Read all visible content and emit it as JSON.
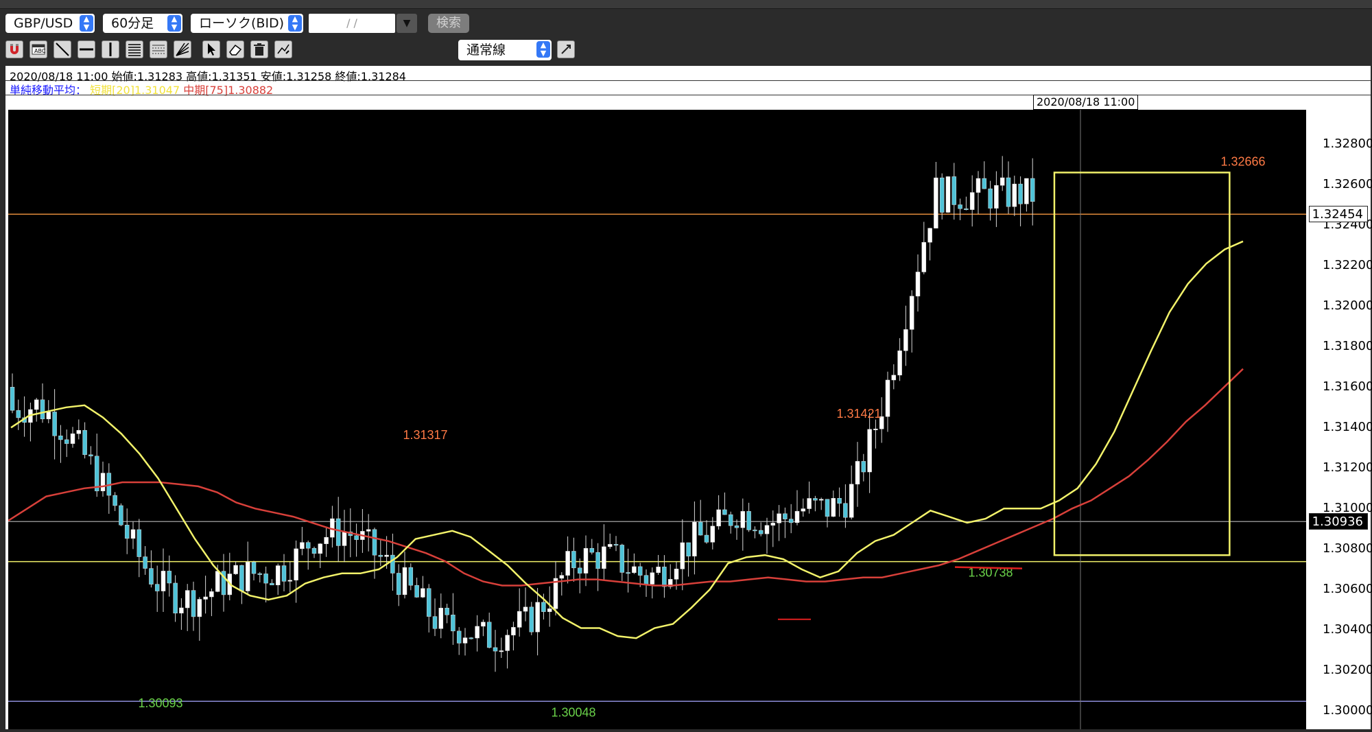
{
  "toolbar": {
    "symbol": "GBP/USD",
    "timeframe": "60分足",
    "chart_type": "ローソク(BID)",
    "date_placeholder": "/ /",
    "search_label": "検索",
    "line_width": "1",
    "line_style": "通常線",
    "palette": [
      "#62c8e8",
      "#f29a4a",
      "#f7e94a",
      "#63d24a",
      "#f08ce8",
      "#e83a78",
      "#999999",
      "#4aa0f0"
    ],
    "highlight_color": "#fbf29a",
    "tools": [
      "magnet-icon",
      "text-box-icon",
      "trend-line-icon",
      "horizontal-line-icon",
      "vertical-line-icon",
      "fibonacci-icon",
      "channel-icon",
      "gann-fan-icon",
      "pointer-icon",
      "eraser-icon",
      "trash-icon",
      "auto-draw-icon"
    ]
  },
  "info": {
    "ohlc_line": "2020/08/18 11:00 始値:1.31283 高値:1.31351 安値:1.31258 終値:1.31284",
    "ma_label": "単純移動平均：",
    "ma_short": "短期[20]1.31047",
    "ma_mid": "中期[75]1.30882"
  },
  "crosshair": {
    "time_label": "2020/08/18 11:00"
  },
  "chart_data": {
    "type": "candlestick",
    "y_ticks": [
      "1.32800",
      "1.32600",
      "1.32400",
      "1.32200",
      "1.32000",
      "1.31800",
      "1.31600",
      "1.31400",
      "1.31200",
      "1.31000",
      "1.30800",
      "1.30600",
      "1.30400",
      "1.30200",
      "1.30000"
    ],
    "ylim": [
      1.2991,
      1.3297
    ],
    "price_badges": [
      {
        "value": "1.30936",
        "style": "dark"
      },
      {
        "value": "1.32454",
        "style": "light"
      }
    ],
    "horizontal_lines": [
      {
        "value": 1.32454,
        "color": "#e08a3a"
      },
      {
        "value": 1.30936,
        "color": "#8a8a8a"
      },
      {
        "value": 1.30738,
        "color": "#f2f26a"
      },
      {
        "value": 1.30048,
        "color": "#8c8cd8"
      }
    ],
    "annotations": [
      {
        "text": "1.32666",
        "price": 1.32666,
        "color": "#ff7a45",
        "pos": "above"
      },
      {
        "text": "1.31421",
        "price": 1.31421,
        "color": "#ff7a45",
        "pos": "above"
      },
      {
        "text": "1.31317",
        "price": 1.31317,
        "color": "#ff7a45",
        "pos": "above"
      },
      {
        "text": "1.30093",
        "price": 1.30093,
        "color": "#6ad24a",
        "pos": "below"
      },
      {
        "text": "1.30048",
        "price": 1.30048,
        "color": "#6ad24a",
        "pos": "below"
      },
      {
        "text": "1.30738",
        "price": 1.30738,
        "color": "#6ad24a",
        "pos": "below"
      }
    ],
    "ma_short": {
      "period": 20,
      "color": "#f2f26a",
      "points": [
        1.314,
        1.3146,
        1.3148,
        1.315,
        1.3151,
        1.3145,
        1.3137,
        1.3127,
        1.3115,
        1.31,
        1.3085,
        1.3072,
        1.3062,
        1.3057,
        1.3055,
        1.3057,
        1.3063,
        1.3066,
        1.3068,
        1.3068,
        1.307,
        1.3076,
        1.3085,
        1.3087,
        1.3089,
        1.3086,
        1.3079,
        1.3072,
        1.3063,
        1.3055,
        1.3046,
        1.3041,
        1.3041,
        1.3037,
        1.3036,
        1.3041,
        1.3043,
        1.3051,
        1.306,
        1.3073,
        1.3076,
        1.3077,
        1.3075,
        1.307,
        1.3066,
        1.3069,
        1.3078,
        1.3084,
        1.3087,
        1.3093,
        1.3099,
        1.3096,
        1.3093,
        1.3095,
        1.31,
        1.31,
        1.31,
        1.3104,
        1.311,
        1.3122,
        1.3138,
        1.3158,
        1.3178,
        1.3197,
        1.3211,
        1.3221,
        1.3228,
        1.3232
      ]
    },
    "ma_mid": {
      "period": 75,
      "color": "#d8403a",
      "points": [
        1.3094,
        1.31,
        1.3106,
        1.3108,
        1.311,
        1.3111,
        1.3113,
        1.3113,
        1.3113,
        1.3112,
        1.3111,
        1.3108,
        1.3103,
        1.31,
        1.3098,
        1.3096,
        1.3093,
        1.309,
        1.3088,
        1.3086,
        1.3084,
        1.3081,
        1.3078,
        1.3074,
        1.3068,
        1.3064,
        1.3062,
        1.3062,
        1.3063,
        1.3064,
        1.3065,
        1.3065,
        1.3064,
        1.3063,
        1.3062,
        1.3062,
        1.3063,
        1.3064,
        1.3064,
        1.3065,
        1.3066,
        1.3065,
        1.3064,
        1.3064,
        1.3065,
        1.3066,
        1.3066,
        1.3068,
        1.307,
        1.3072,
        1.3075,
        1.3079,
        1.3083,
        1.3087,
        1.3091,
        1.3095,
        1.31,
        1.3104,
        1.311,
        1.3116,
        1.3124,
        1.3133,
        1.3143,
        1.3151,
        1.316,
        1.3169
      ]
    },
    "highlight_box": {
      "x_from": 0.806,
      "x_to": 0.941,
      "price_top": 1.3266,
      "price_bottom": 1.3077,
      "color": "#f2f26a"
    },
    "candles_summary": "GBP/USD hourly candlesticks ranging between 1.30048 and 1.32666, with a sharp rally into the highlighted region"
  }
}
